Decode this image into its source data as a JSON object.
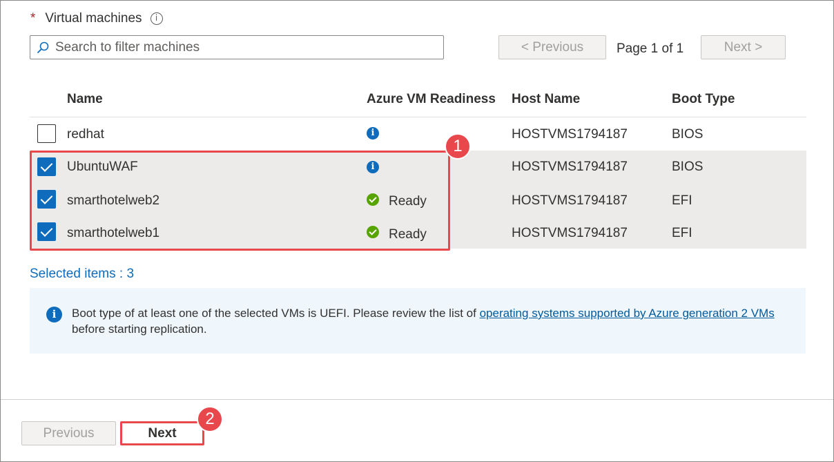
{
  "section": {
    "required_marker": "*",
    "label": "Virtual machines",
    "info_icon": "info-icon"
  },
  "search": {
    "placeholder": "Search to filter machines",
    "value": ""
  },
  "pager": {
    "previous_label": "< Previous",
    "page_text": "Page 1 of 1",
    "next_label": "Next >"
  },
  "table": {
    "columns": [
      "Name",
      "Azure VM Readiness",
      "Host Name",
      "Boot Type"
    ],
    "rows": [
      {
        "checked": false,
        "name": "redhat",
        "readiness": "",
        "readiness_icon": "info-icon",
        "host": "HOSTVMS1794187",
        "boot": "BIOS"
      },
      {
        "checked": true,
        "name": "UbuntuWAF",
        "readiness": "",
        "readiness_icon": "info-icon",
        "host": "HOSTVMS1794187",
        "boot": "BIOS"
      },
      {
        "checked": true,
        "name": "smarthotelweb2",
        "readiness": "Ready",
        "readiness_icon": "check-circle-icon",
        "host": "HOSTVMS1794187",
        "boot": "EFI"
      },
      {
        "checked": true,
        "name": "smarthotelweb1",
        "readiness": "Ready",
        "readiness_icon": "check-circle-icon",
        "host": "HOSTVMS1794187",
        "boot": "EFI"
      }
    ]
  },
  "selected_count_text": "Selected items : 3",
  "message": {
    "text_before": "Boot type of at least one of the selected VMs is UEFI. Please review the list of ",
    "link_text": "operating systems supported by Azure generation 2 VMs",
    "text_after": " before starting replication."
  },
  "callouts": {
    "one": "1",
    "two": "2"
  },
  "footer": {
    "previous_label": "Previous",
    "next_label": "Next"
  },
  "colors": {
    "accent": "#0f6cbd",
    "highlight": "#e8474b",
    "success": "#57a300"
  }
}
